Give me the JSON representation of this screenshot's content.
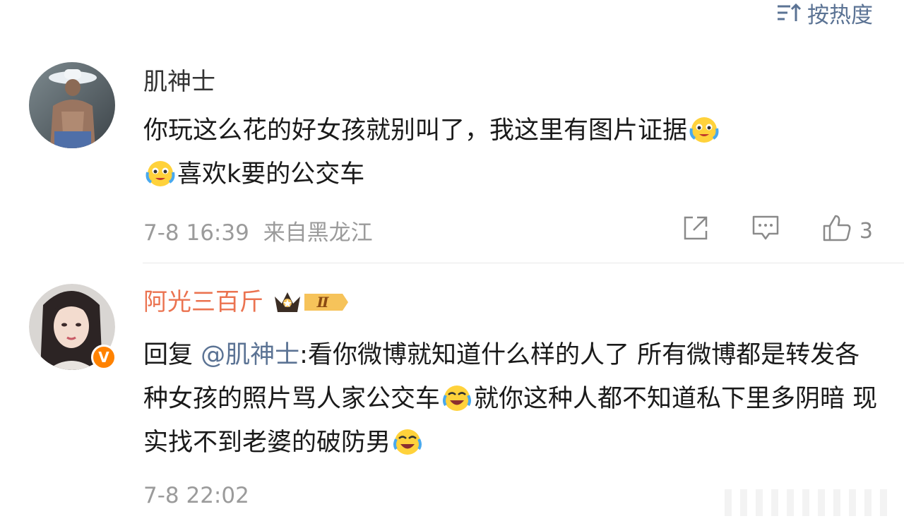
{
  "sort": {
    "label": "按热度"
  },
  "comments": [
    {
      "username": "肌神士",
      "text_parts": [
        "你玩这么花的好女孩就别叫了，我这里有图片证据",
        "",
        "喜欢k要的公交车"
      ],
      "emoji_names": [
        "crying-smile-emoji",
        "crying-smile-emoji"
      ],
      "timestamp": "7-8 16:39",
      "location": "来自黑龙江",
      "like_count": "3"
    },
    {
      "username": "阿光三百斤",
      "badge_text": "Ⅱ",
      "verified_badge": "V",
      "reply_prefix": "回复",
      "mention": "@肌神士",
      "text_parts": [
        ":看你微博就知道什么样的人了 所有微博都是转发各种女孩的照片骂人家公交车",
        "就你这种人都不知道私下里多阴暗 现实找不到老婆的破防男",
        ""
      ],
      "emoji_names": [
        "laughing-crying-emoji",
        "laughing-crying-emoji"
      ],
      "timestamp": "7-8 22:02"
    }
  ],
  "colors": {
    "username_vip": "#eb7350",
    "link": "#5b7394",
    "meta": "#9b9b9b"
  }
}
